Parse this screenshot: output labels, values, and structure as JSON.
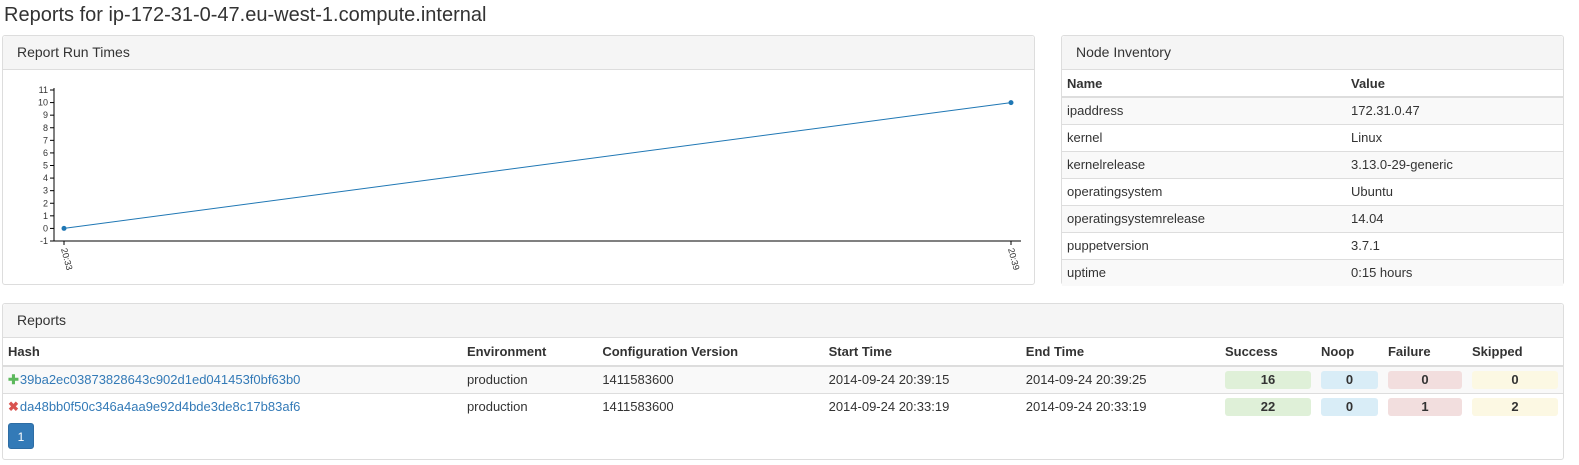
{
  "page": {
    "title": "Reports for ip-172-31-0-47.eu-west-1.compute.internal"
  },
  "runtimes_panel": {
    "heading": "Report Run Times"
  },
  "chart_data": {
    "type": "line",
    "categories": [
      "20:33",
      "20:39"
    ],
    "series": [
      {
        "name": "Report Run Times",
        "values": [
          0,
          10
        ],
        "color": "#1f77b4"
      }
    ],
    "ylim": [
      -1,
      11
    ],
    "yticks": [
      -1,
      0,
      1,
      2,
      3,
      4,
      5,
      6,
      7,
      8,
      9,
      10,
      11
    ],
    "legend": "bottom-center"
  },
  "inventory": {
    "heading": "Node Inventory",
    "columns": [
      "Name",
      "Value"
    ],
    "rows": [
      [
        "ipaddress",
        "172.31.0.47"
      ],
      [
        "kernel",
        "Linux"
      ],
      [
        "kernelrelease",
        "3.13.0-29-generic"
      ],
      [
        "operatingsystem",
        "Ubuntu"
      ],
      [
        "operatingsystemrelease",
        "14.04"
      ],
      [
        "puppetversion",
        "3.7.1"
      ],
      [
        "uptime",
        "0:15 hours"
      ]
    ]
  },
  "reports": {
    "heading": "Reports",
    "columns": [
      "Hash",
      "Environment",
      "Configuration Version",
      "Start Time",
      "End Time",
      "Success",
      "Noop",
      "Failure",
      "Skipped"
    ],
    "rows": [
      {
        "status": "success",
        "status_icon": "✚",
        "status_icon_name": "plus-icon",
        "hash": "39ba2ec03873828643c902d1ed041453f0bf63b0",
        "environment": "production",
        "config_version": "1411583600",
        "start_time": "2014-09-24 20:39:15",
        "end_time": "2014-09-24 20:39:25",
        "success": "16",
        "noop": "0",
        "failure": "0",
        "skipped": "0"
      },
      {
        "status": "failed",
        "status_icon": "✖",
        "status_icon_name": "cross-icon",
        "hash": "da48bb0f50c346a4aa9e92d4bde3de8c17b83af6",
        "environment": "production",
        "config_version": "1411583600",
        "start_time": "2014-09-24 20:33:19",
        "end_time": "2014-09-24 20:33:19",
        "success": "22",
        "noop": "0",
        "failure": "1",
        "skipped": "2"
      }
    ],
    "pagination": {
      "current_page": "1"
    }
  },
  "colors": {
    "link": "#337ab7",
    "success_icon": "#5cb85c",
    "failure_icon": "#d9534f",
    "success_badge": "#dff0d8",
    "noop_badge": "#d9edf7",
    "failure_badge": "#f2dede",
    "skipped_badge": "#fcf8e3"
  }
}
